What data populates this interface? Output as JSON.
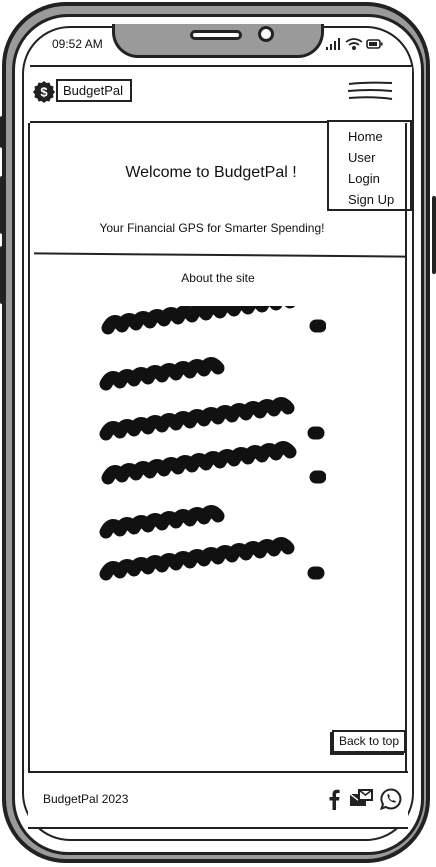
{
  "status_bar": {
    "time": "09:52 AM"
  },
  "navbar": {
    "brand": "BudgetPal",
    "menu": [
      "Home",
      "User",
      "Login",
      "Sign Up"
    ]
  },
  "hero": {
    "title": "Welcome to BudgetPal !",
    "tagline": "Your Financial GPS for Smarter Spending!"
  },
  "about": {
    "title": "About the site"
  },
  "back_to_top": "Back to top",
  "footer": {
    "copyright": "BudgetPal 2023",
    "social": [
      "facebook-icon",
      "email-icon",
      "whatsapp-icon"
    ]
  },
  "colors": {
    "ink": "#222222",
    "frame": "#9a9a9a",
    "background": "#ffffff"
  }
}
